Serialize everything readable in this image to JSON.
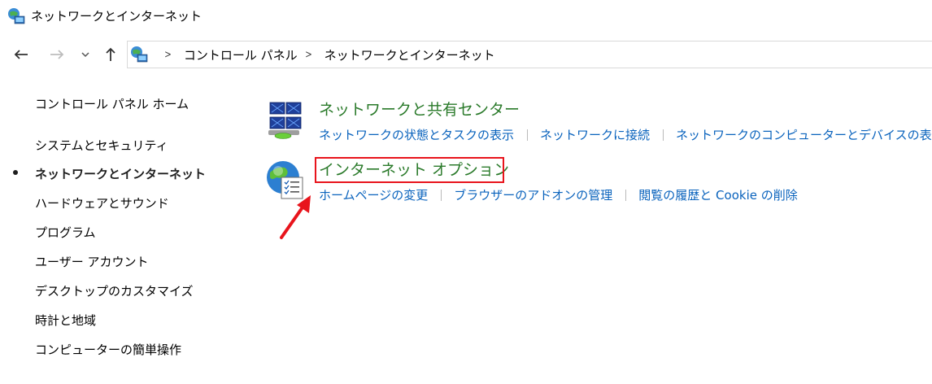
{
  "window": {
    "title": "ネットワークとインターネット",
    "icon": "network-globe-icon"
  },
  "nav": {
    "back_icon": "arrow-left-icon",
    "forward_icon": "arrow-right-icon",
    "recent_icon": "chevron-down-icon",
    "up_icon": "arrow-up-icon"
  },
  "address": {
    "icon": "network-globe-icon",
    "separator": ">",
    "crumbs": [
      "コントロール パネル",
      "ネットワークとインターネット"
    ]
  },
  "sidebar": {
    "items": [
      {
        "label": "コントロール パネル ホーム",
        "active": false
      },
      {
        "label": "システムとセキュリティ",
        "active": false
      },
      {
        "label": "ネットワークとインターネット",
        "active": true
      },
      {
        "label": "ハードウェアとサウンド",
        "active": false
      },
      {
        "label": "プログラム",
        "active": false
      },
      {
        "label": "ユーザー アカウント",
        "active": false
      },
      {
        "label": "デスクトップのカスタマイズ",
        "active": false
      },
      {
        "label": "時計と地域",
        "active": false
      },
      {
        "label": "コンピューターの簡単操作",
        "active": false
      }
    ]
  },
  "categories": [
    {
      "title": "ネットワークと共有センター",
      "icon": "network-sharing-center-icon",
      "links": [
        "ネットワークの状態とタスクの表示",
        "ネットワークに接続",
        "ネットワークのコンピューターとデバイスの表示"
      ]
    },
    {
      "title": "インターネット オプション",
      "icon": "internet-options-icon",
      "links": [
        "ホームページの変更",
        "ブラウザーのアドオンの管理",
        "閲覧の履歴と Cookie の削除"
      ]
    }
  ],
  "colors": {
    "category_title": "#2a7a2a",
    "link": "#0a63bd",
    "highlight": "#e8141c",
    "arrow": "#e8141c"
  }
}
